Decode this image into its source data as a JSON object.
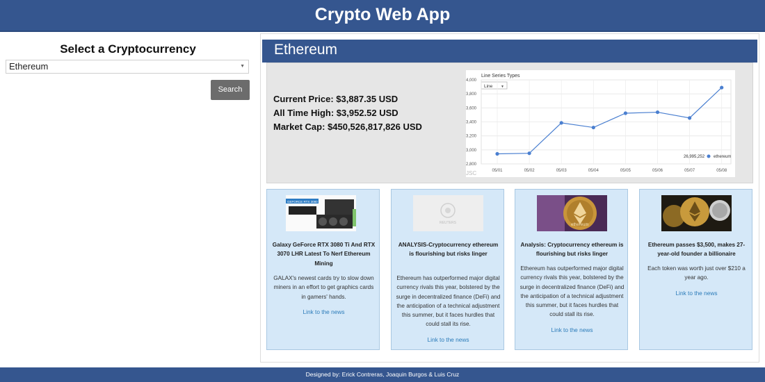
{
  "app": {
    "title": "Crypto Web App"
  },
  "sidebar": {
    "heading": "Select a Cryptocurrency",
    "select_value": "Ethereum",
    "search_label": "Search"
  },
  "coin": {
    "name": "Ethereum",
    "stats": {
      "current_price": "Current Price: $3,887.35 USD",
      "all_time_high": "All Time High: $3,952.52 USD",
      "market_cap": "Market Cap: $450,526,817,826 USD"
    }
  },
  "chart_data": {
    "type": "line",
    "title": "Line Series Types",
    "dropdown_value": "Line",
    "categories": [
      "05/01",
      "05/02",
      "05/03",
      "05/04",
      "05/05",
      "05/06",
      "05/07",
      "05/08"
    ],
    "series": [
      {
        "name": "ethereum",
        "values": [
          2944,
          2952,
          3386,
          3320,
          3524,
          3538,
          3456,
          3890
        ],
        "color": "#4a7fd0"
      }
    ],
    "ylim": [
      2800,
      4000
    ],
    "yticks": [
      "4,000",
      "3,800",
      "3,600",
      "3,400",
      "3,200",
      "3,000",
      "2,800"
    ],
    "tooltip_value": "26,995,252",
    "watermark": "JSC",
    "grid": true,
    "legend_position": "bottom-right"
  },
  "news": [
    {
      "title": "Galaxy GeForce RTX 3080 Ti And RTX 3070 LHR Latest To Nerf Ethereum Mining",
      "description": "GALAX's newest cards try to slow down miners in an effort to get graphics cards in gamers' hands.",
      "link": "Link to the news",
      "image_label": "GEFORCE RTX 3080"
    },
    {
      "title": "ANALYSIS-Cryptocurrency ethereum is flourishing but risks linger",
      "description": "Ethereum has outperformed major digital currency rivals this year, bolstered by the surge in decentralized finance (DeFi) and the anticipation of a technical adjustment this summer, but it faces hurdles that could stall its rise.",
      "link": "Link to the news",
      "image_label": "REUTERS"
    },
    {
      "title": "Analysis: Cryptocurrency ethereum is flourishing but risks linger",
      "description": "Ethereum has outperformed major digital currency rivals this year, bolstered by the surge in decentralized finance (DeFi) and the anticipation of a technical adjustment this summer, but it faces hurdles that could stall its rise.",
      "link": "Link to the news",
      "image_label": "ethereum"
    },
    {
      "title": "Ethereum passes $3,500, makes 27-year-old founder a billionaire",
      "description": "Each token was worth just over $210 a year ago.",
      "link": "Link to the news",
      "image_label": ""
    }
  ],
  "footer": {
    "credits": "Designed by: Erick Contreras, Joaquin Burgos & Luis Cruz"
  }
}
